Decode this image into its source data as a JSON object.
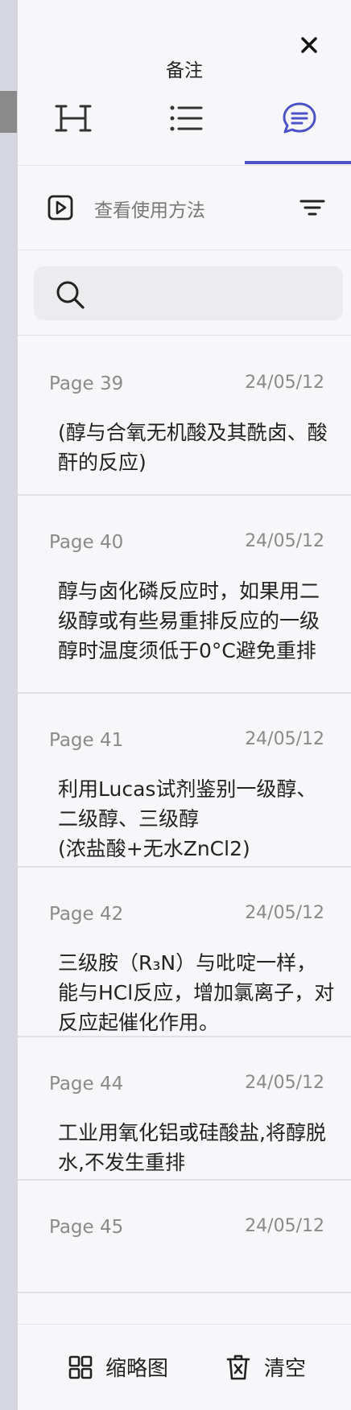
{
  "panel": {
    "title": "备注",
    "tabs": [
      {
        "name": "heading-icon"
      },
      {
        "name": "list-icon"
      },
      {
        "name": "comment-icon",
        "active": true
      }
    ]
  },
  "toolbar": {
    "howto_label": "查看使用方法"
  },
  "search": {
    "placeholder": ""
  },
  "notes": [
    {
      "page": "Page 39",
      "date": "24/05/12",
      "text": "(醇与合氧无机酸及其酰卤、酸酐的反应)"
    },
    {
      "page": "Page 40",
      "date": "24/05/12",
      "text": "醇与卤化磷反应时，如果用二级醇或有些易重排反应的一级醇时温度须低于0°C避免重排"
    },
    {
      "page": "Page 41",
      "date": "24/05/12",
      "text": "利用Lucas试剂鉴别一级醇、二级醇、三级醇\n(浓盐酸+无水ZnCl2)"
    },
    {
      "page": "Page 42",
      "date": "24/05/12",
      "text": "三级胺（R₃N）与吡啶一样，能与HCl反应，增加氯离子，对反应起催化作用。"
    },
    {
      "page": "Page 44",
      "date": "24/05/12",
      "text": "工业用氧化铝或硅酸盐,将醇脱水,不发生重排"
    },
    {
      "page": "Page 45",
      "date": "24/05/12",
      "text": ""
    }
  ],
  "bottom": {
    "thumbnail_label": "缩略图",
    "clear_label": "清空"
  },
  "colors": {
    "accent": "#4b52c8",
    "muted_text": "#8a8a8a",
    "background": "#f7f7f9"
  }
}
